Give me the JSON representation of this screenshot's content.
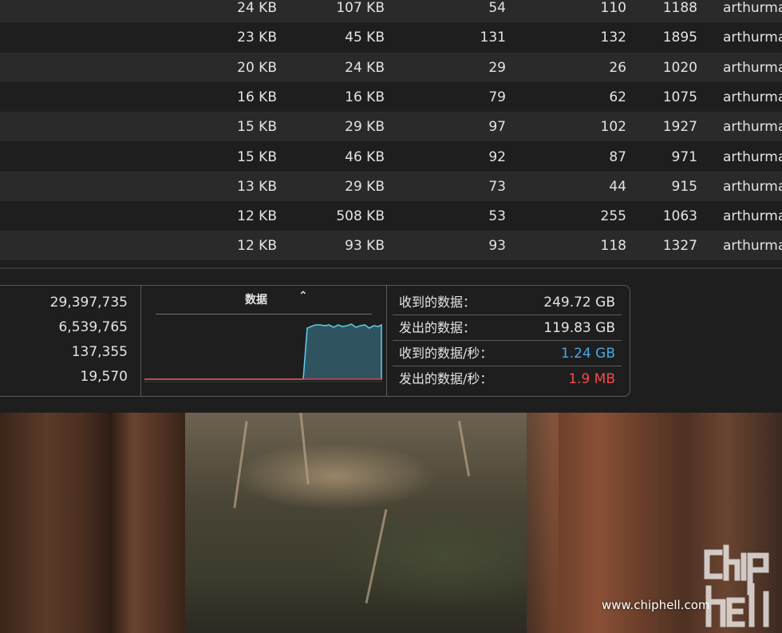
{
  "process_table": {
    "rows": [
      {
        "c1": "24 KB",
        "c2": "107 KB",
        "c3": "54",
        "c4": "110",
        "c5": "1188",
        "c6": "arthurma"
      },
      {
        "c1": "23 KB",
        "c2": "45 KB",
        "c3": "131",
        "c4": "132",
        "c5": "1895",
        "c6": "arthurma"
      },
      {
        "c1": "20 KB",
        "c2": "24 KB",
        "c3": "29",
        "c4": "26",
        "c5": "1020",
        "c6": "arthurma"
      },
      {
        "c1": "16 KB",
        "c2": "16 KB",
        "c3": "79",
        "c4": "62",
        "c5": "1075",
        "c6": "arthurma"
      },
      {
        "c1": "15 KB",
        "c2": "29 KB",
        "c3": "97",
        "c4": "102",
        "c5": "1927",
        "c6": "arthurma"
      },
      {
        "c1": "15 KB",
        "c2": "46 KB",
        "c3": "92",
        "c4": "87",
        "c5": "971",
        "c6": "arthurma"
      },
      {
        "c1": "13 KB",
        "c2": "29 KB",
        "c3": "73",
        "c4": "44",
        "c5": "915",
        "c6": "arthurma"
      },
      {
        "c1": "12 KB",
        "c2": "508 KB",
        "c3": "53",
        "c4": "255",
        "c5": "1063",
        "c6": "arthurma"
      },
      {
        "c1": "12 KB",
        "c2": "93 KB",
        "c3": "93",
        "c4": "118",
        "c5": "1327",
        "c6": "arthurma"
      }
    ]
  },
  "left_stats": [
    "29,397,735",
    "6,539,765",
    "137,355",
    "19,570"
  ],
  "graph": {
    "selector_label": "数据",
    "chevron_icon": "up-down-chevron-icon",
    "received_color": "#5ac8e6",
    "sent_color": "#e0434b"
  },
  "right_stats": [
    {
      "key": "收到的数据：",
      "value": "249.72 GB",
      "color": "#e4e4e4"
    },
    {
      "key": "发出的数据：",
      "value": "119.83 GB",
      "color": "#e4e4e4"
    },
    {
      "key": "收到的数据/秒：",
      "value": "1.24 GB",
      "color": "#4aa8e6"
    },
    {
      "key": "发出的数据/秒：",
      "value": "1.9 MB",
      "color": "#f44a4a"
    }
  ],
  "watermark": {
    "text": "www.chiphell.com",
    "logo_icon": "chiphell-logo-icon"
  }
}
